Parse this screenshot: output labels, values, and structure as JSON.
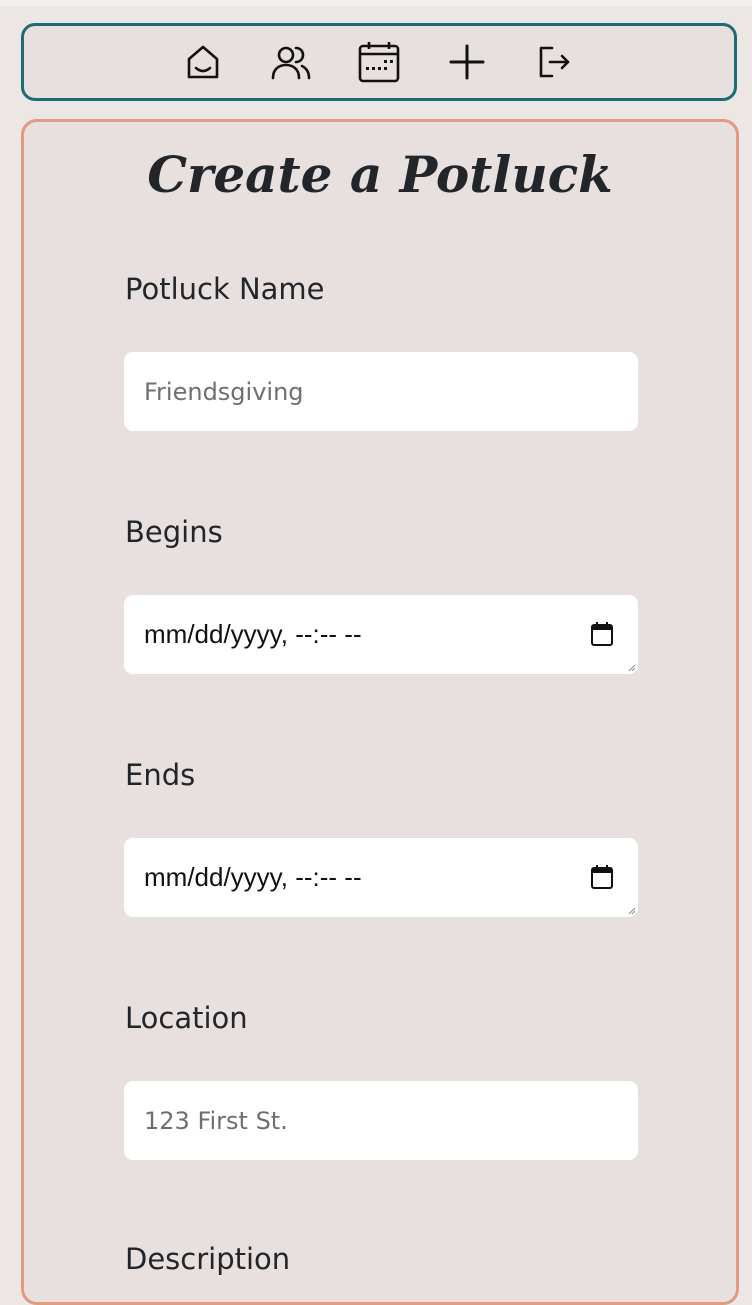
{
  "nav": {
    "items": [
      {
        "icon": "home-icon",
        "label": "Home"
      },
      {
        "icon": "users-icon",
        "label": "Friends"
      },
      {
        "icon": "calendar-icon",
        "label": "Calendar"
      },
      {
        "icon": "plus-icon",
        "label": "Create"
      },
      {
        "icon": "logout-icon",
        "label": "Log out"
      }
    ]
  },
  "form": {
    "title": "Create a Potluck",
    "name": {
      "label": "Potluck Name",
      "placeholder": "Friendsgiving"
    },
    "begins": {
      "label": "Begins",
      "value": "mm/dd/yyyy, --:-- --"
    },
    "ends": {
      "label": "Ends",
      "value": "mm/dd/yyyy, --:-- --"
    },
    "location": {
      "label": "Location",
      "placeholder": "123 First St."
    },
    "description": {
      "label": "Description"
    }
  },
  "colors": {
    "nav_border": "#1d6b73",
    "card_border": "#e39a7e",
    "background": "#e8dfdf",
    "text": "#22262a"
  }
}
